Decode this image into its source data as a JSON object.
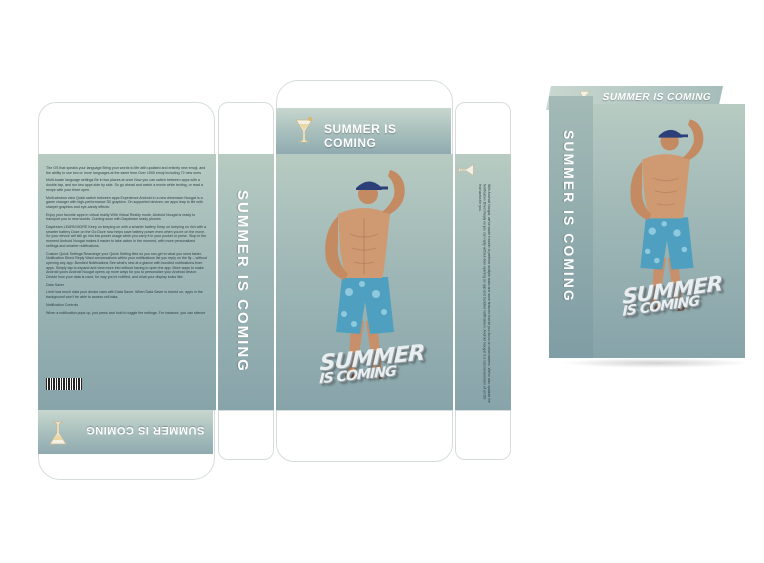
{
  "brand": {
    "title": "SUMMER IS COMING",
    "logo_line1": "SUMMER",
    "logo_line2": "IS COMING"
  },
  "colors": {
    "panel_top": "#b7cbc2",
    "panel_bottom": "#87a4aa",
    "title_text": "#ffffff"
  },
  "icons": {
    "top_flap": "cocktail-glass-icon",
    "bottom_flap": "cocktail-glass-icon",
    "box_top": "cocktail-glass-icon"
  },
  "back_text": [
    "The OS that speaks your language Bring your words to life with updated and entirely new emoji, and the ability to use two or more languages at the same time.Over 1500 emoji including 72 new ones",
    "Multi-locale language settings Be in two places at once Now you can switch between apps with a double-tap, and run two apps side by side. So go ahead and watch a movie while texting, or read a recipe with your timer open.",
    "Multi-window view Quick switch between apps Experience Android in a new dimension Nougat is a game changer with high-performance 3D graphics. On supported devices, we apps leap to life with sharper graphics and eye-candy effects.",
    "Enjoy your favorite apps in virtual reality With Virtual Reality mode, Android Nougat is ready to transport you to new worlds. Coming soon with Daydream ready phones",
    "Daydream LEARN MORE Keep on keeping on with a smarter battery Keep on keeping on rich with a smarter battery Doze on the Go Doze now helps save battery power even when you're on the move. So your device will still go into low power usage while you carry it in your pocket or purse. Stop in the moment Android Nougat makes it easier to take action in the moment, with more personalized settings and smarter notifications.",
    "Custom Quick Settings Rearrange your Quick Setting tiles so you can get to what you need faster. Notification Direct Reply Want conversations within your notifications list you reply on the fly – without opening any app. Bundled Notifications See what's new at a glance with bundled notifications from apps. Simply tap to expand and view more info without having to open the app. More ways to make Android yours Android Nougat opens up more ways for you to personalize your Android device. Decide how your data is used, for way you're notified, and what your display looks like.",
    "Data Saver",
    "Limit how much data your device uses with Data Saver. When Data Saver is turned on, apps in the background won't be able to access cell data.",
    "Notification Controls",
    "When a notification pops up, just press and hold to toggle the settings. For instance, you can silence"
  ],
  "side_text": "With Android Nougat, we've made it easier to perform multiple tasks and more features that let you focus on what matters. We've also updated the Notification Direct Reply so you can reply without ever opening an app and bundled notifications. Android Nougat is a natural evolution of an OS that works for you."
}
